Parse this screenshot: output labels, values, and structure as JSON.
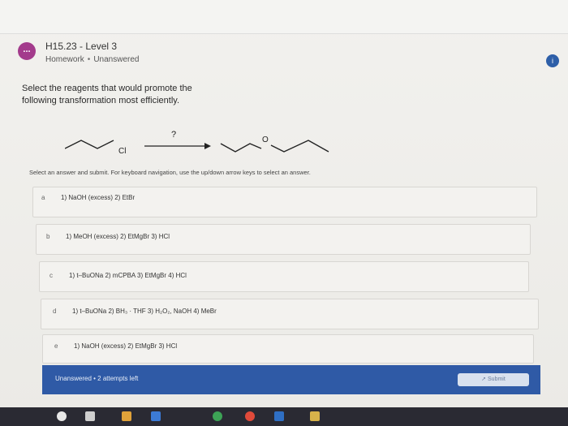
{
  "header": {
    "menu_label": "...",
    "title": "H15.23 - Level 3",
    "category": "Homework",
    "separator": "•",
    "status": "Unanswered"
  },
  "info_icon": "i",
  "question": "Select the reagents that would promote the following transformation most efficiently.",
  "reaction": {
    "reactant_label": "Cl",
    "arrow_label": "?",
    "product_label": "O"
  },
  "instructions": "Select an answer and submit. For keyboard navigation, use the up/down arrow keys to select an answer.",
  "options": [
    {
      "letter": "a",
      "text": "1) NaOH (excess) 2) EtBr"
    },
    {
      "letter": "b",
      "text": "1) MeOH (excess) 2) EtMgBr 3) HCl"
    },
    {
      "letter": "c",
      "text": "1) t–BuONa 2) mCPBA 3) EtMgBr 4) HCl"
    },
    {
      "letter": "d",
      "text": "1) t–BuONa 2) BH₃ · THF 3) H₂O₂, NaOH 4) MeBr"
    },
    {
      "letter": "e",
      "text": "1) NaOH (excess) 2) EtMgBr 3) HCl"
    }
  ],
  "footer": {
    "status_text": "Unanswered • 2 attempts left",
    "submit_label": "Submit"
  },
  "colors": {
    "accent": "#2f5aa6",
    "menu_dot": "#a33b8c"
  }
}
